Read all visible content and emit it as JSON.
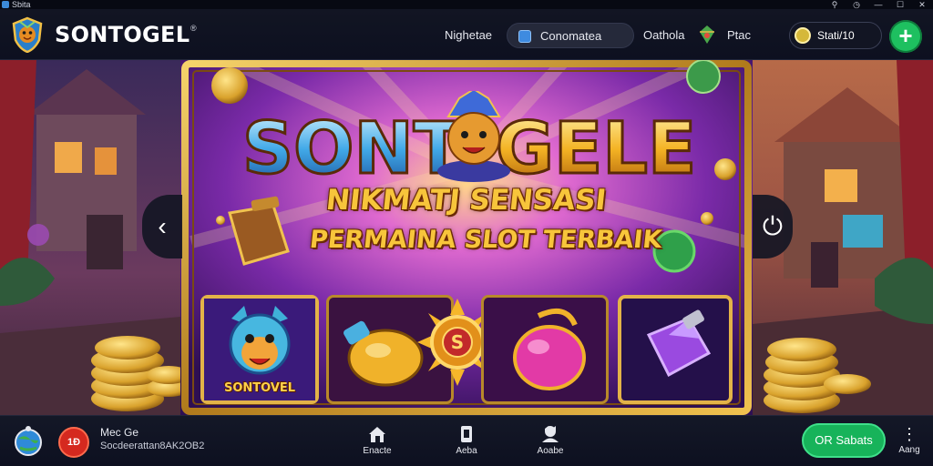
{
  "window": {
    "title": "Sbita",
    "controls": [
      "⚲",
      "◷",
      "—",
      "☐",
      "✕"
    ]
  },
  "header": {
    "brand": "SONTOGEL",
    "brand_mark": "®",
    "nav": [
      {
        "label": "Nighetae"
      },
      {
        "label": "Conomatea"
      },
      {
        "label": "Oathola"
      },
      {
        "label": "Ptac"
      }
    ],
    "coin_label": "Stati/10",
    "add_label": "+",
    "icons": [
      "shield-logo-icon",
      "search-icon",
      "gem-icon",
      "coin-icon",
      "plus-icon"
    ]
  },
  "banner": {
    "title": "SONT GELE",
    "title_left": "SONT",
    "title_right": "GELE",
    "tagline_line1": "NIKMATJ SENSASI",
    "tagline_line2": "PERMAINA SLOT TERBAIK",
    "prev_label": "‹",
    "next_label": "⏻",
    "tiles": [
      {
        "label": "SONTOVEL",
        "icon": "tiger-icon"
      },
      {
        "label": "",
        "icon": "potion-icon"
      },
      {
        "label": "",
        "icon": "sun-coin-icon"
      },
      {
        "label": "",
        "icon": "pink-bag-icon"
      },
      {
        "label": "",
        "icon": "purple-gem-icon"
      }
    ]
  },
  "bottom": {
    "avatar_label": "",
    "avatar2_label": "1Ð",
    "user_name": "Mec Ge",
    "user_subtitle": "Socdeerattan8AK2OB2",
    "nav": [
      {
        "label": "Enacte",
        "icon": "home-icon"
      },
      {
        "label": "Aeba",
        "icon": "card-icon"
      },
      {
        "label": "Aoabe",
        "icon": "profile-icon"
      }
    ],
    "cta_label": "OR Sabats",
    "more_label": "Aang",
    "more_icon": "more-vertical-icon"
  },
  "colors": {
    "accent_green": "#1ec060",
    "gold": "#f7c53b",
    "header_bg": "#121523",
    "banner_purple": "#5a1e8c"
  }
}
